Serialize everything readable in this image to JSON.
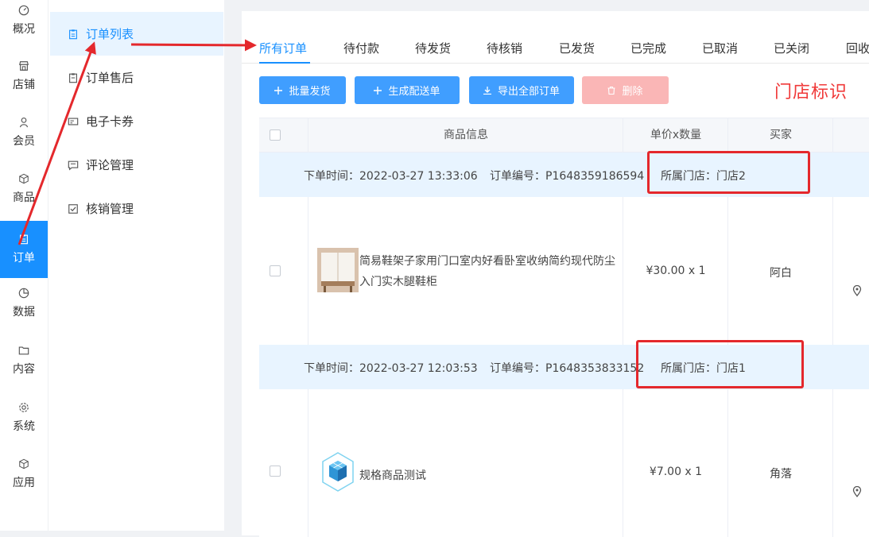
{
  "rail": {
    "items": [
      {
        "label": "概况",
        "icon": "dashboard-icon"
      },
      {
        "label": "店铺",
        "icon": "shop-icon"
      },
      {
        "label": "会员",
        "icon": "member-icon"
      },
      {
        "label": "商品",
        "icon": "product-icon"
      },
      {
        "label": "订单",
        "icon": "order-icon",
        "active": true
      },
      {
        "label": "数据",
        "icon": "data-icon"
      },
      {
        "label": "内容",
        "icon": "content-icon"
      },
      {
        "label": "系统",
        "icon": "system-icon"
      },
      {
        "label": "应用",
        "icon": "app-icon"
      }
    ]
  },
  "submenu": {
    "items": [
      {
        "label": "订单列表",
        "icon": "clipboard-icon",
        "active": true
      },
      {
        "label": "订单售后",
        "icon": "clipboard-icon"
      },
      {
        "label": "电子卡券",
        "icon": "card-icon"
      },
      {
        "label": "评论管理",
        "icon": "comment-icon"
      },
      {
        "label": "核销管理",
        "icon": "checkbox-icon"
      }
    ]
  },
  "tabs": [
    "所有订单",
    "待付款",
    "待发货",
    "待核销",
    "已发货",
    "已完成",
    "已取消",
    "已关闭",
    "回收"
  ],
  "actions": {
    "batch_ship": "批量发货",
    "create_delivery": "生成配送单",
    "export_all": "导出全部订单",
    "delete": "删除"
  },
  "annotation": {
    "store_tag": "门店标识"
  },
  "table": {
    "headers": {
      "product": "商品信息",
      "price_qty": "单价x数量",
      "buyer": "买家"
    }
  },
  "orders": [
    {
      "time": "下单时间：2022-03-27 13:33:06",
      "number": "订单编号：P1648359186594",
      "store": "所属门店：门店2",
      "product": "简易鞋架子家用门口室内好看卧室收纳简约现代防尘入门实木腿鞋柜",
      "price_qty": "¥30.00 x 1",
      "buyer": "阿白"
    },
    {
      "time": "下单时间：2022-03-27 12:03:53",
      "number": "订单编号：P1648353833152",
      "store": "所属门店：门店1",
      "product": "规格商品测试",
      "price_qty": "¥7.00 x 1",
      "buyer": "角落"
    }
  ],
  "colors": {
    "primary": "#1890ff",
    "button": "#409eff",
    "annotation_red": "#e4282c"
  }
}
